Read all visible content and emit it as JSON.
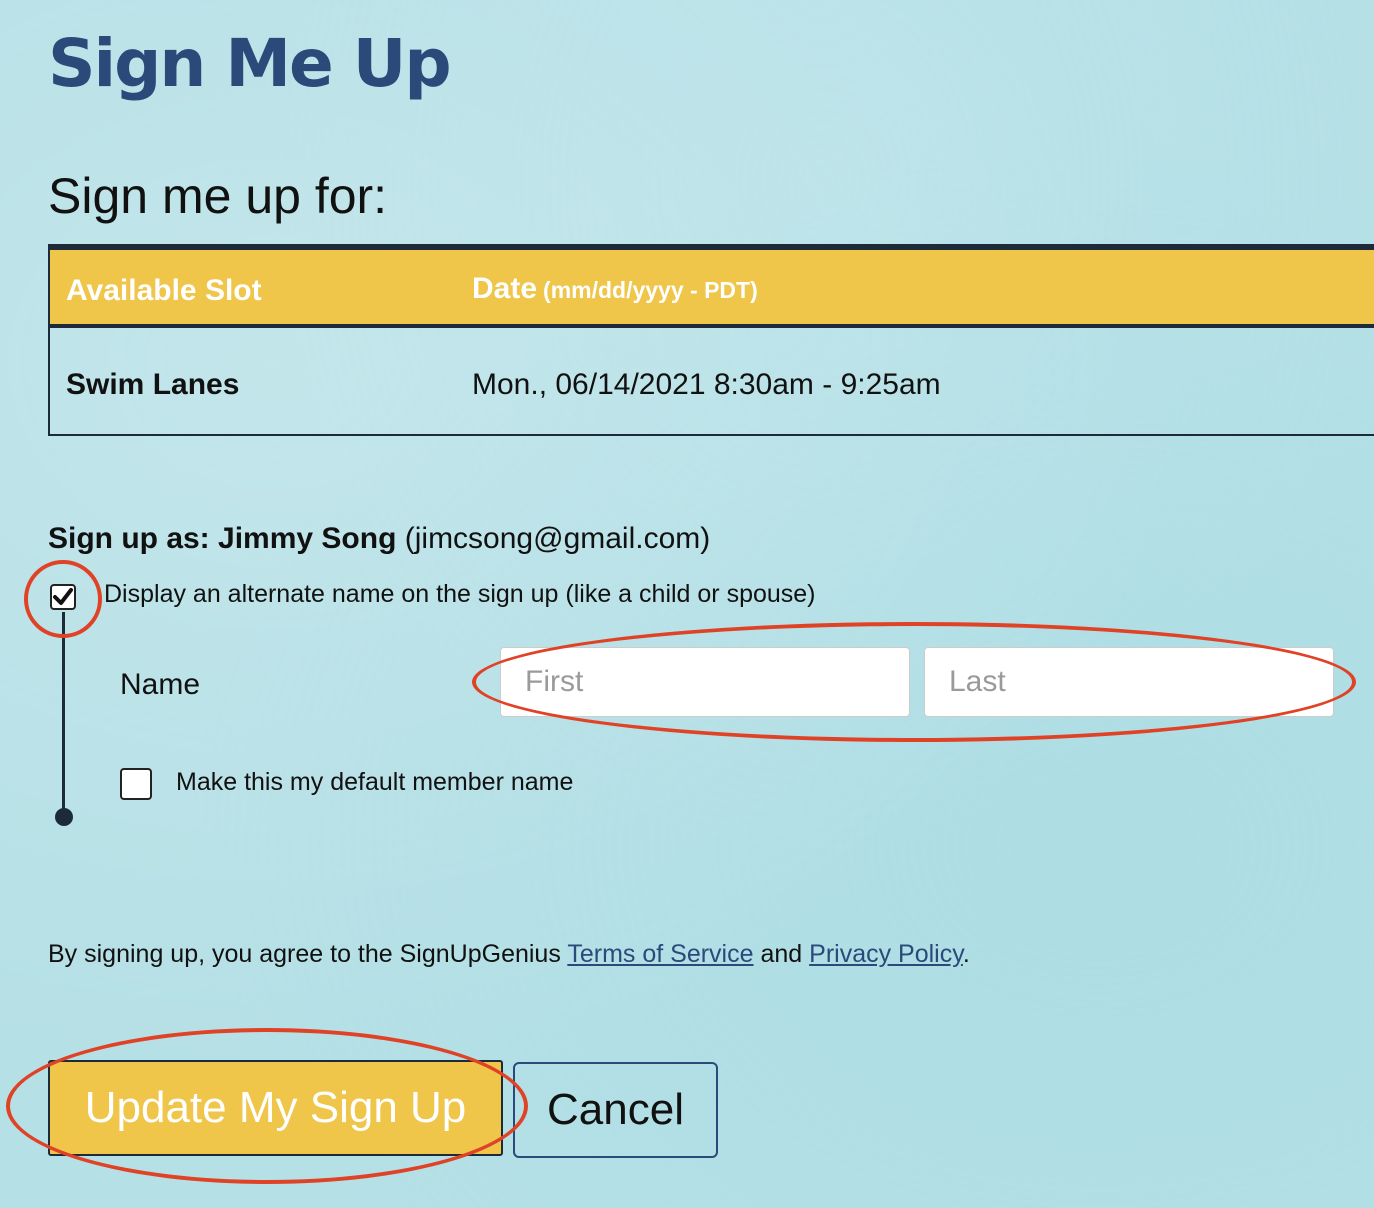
{
  "page": {
    "title": "Sign Me Up",
    "section_title": "Sign me up for:"
  },
  "table": {
    "col_slot": "Available Slot",
    "col_date": "Date",
    "col_date_format": "(mm/dd/yyyy - PDT)",
    "rows": [
      {
        "slot": "Swim Lanes",
        "date": "Mon., 06/14/2021 8:30am - 9:25am"
      }
    ]
  },
  "signup": {
    "prefix": "Sign up as:",
    "name": "Jimmy Song",
    "email": "(jimcsong@gmail.com)",
    "alt_name_label": "Display an alternate name on the sign up (like a child or spouse)",
    "alt_name_checked": true,
    "name_label": "Name",
    "first_placeholder": "First",
    "last_placeholder": "Last",
    "first_value": "",
    "last_value": "",
    "default_label": "Make this my default member name",
    "default_checked": false
  },
  "terms": {
    "prefix": "By signing up, you agree to the SignUpGenius",
    "tos": "Terms of Service",
    "and": "and",
    "privacy": "Privacy Policy",
    "suffix": "."
  },
  "buttons": {
    "update": "Update My Sign Up",
    "cancel": "Cancel"
  },
  "colors": {
    "background": "#b5e0e6",
    "accent_yellow": "#efc54a",
    "title_blue": "#2b4a7a",
    "annotation_red": "#e04226"
  }
}
